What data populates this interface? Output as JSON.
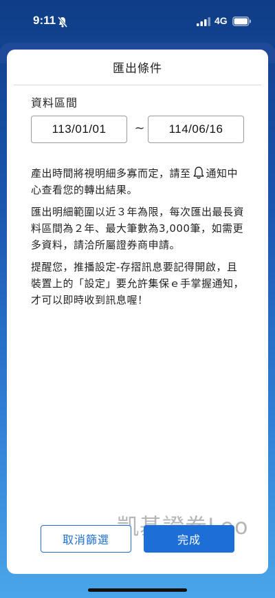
{
  "status_bar": {
    "time": "9:11",
    "network": "4G",
    "icons": [
      "bell-off-icon",
      "signal-icon",
      "battery-icon"
    ]
  },
  "dialog": {
    "title": "匯出條件",
    "section_label": "資料區間",
    "date_start": "113/01/01",
    "date_separator": "~",
    "date_end": "114/06/16",
    "para1_before": "產出時間將視明細多寡而定，請至",
    "para1_after": "通知中心查看您的轉出結果。",
    "para1_icon": "bell-icon",
    "para2": "匯出明細範圍以近３年為限，每次匯出最長資料區間為２年、最大筆數為3,000筆，如需更多資料，請洽所屬證券商申請。",
    "para3": "提醒您，推播設定-存摺訊息要記得開啟，且裝置上的「設定」要允許集保ｅ手掌握通知，才可以即時收到訊息喔！",
    "cancel_label": "取消篩選",
    "done_label": "完成",
    "watermark": "凱基證券Leo"
  },
  "colors": {
    "accent": "#1c6fd6",
    "background_top": "#0f3d86",
    "background_bottom": "#4aa6e8"
  }
}
